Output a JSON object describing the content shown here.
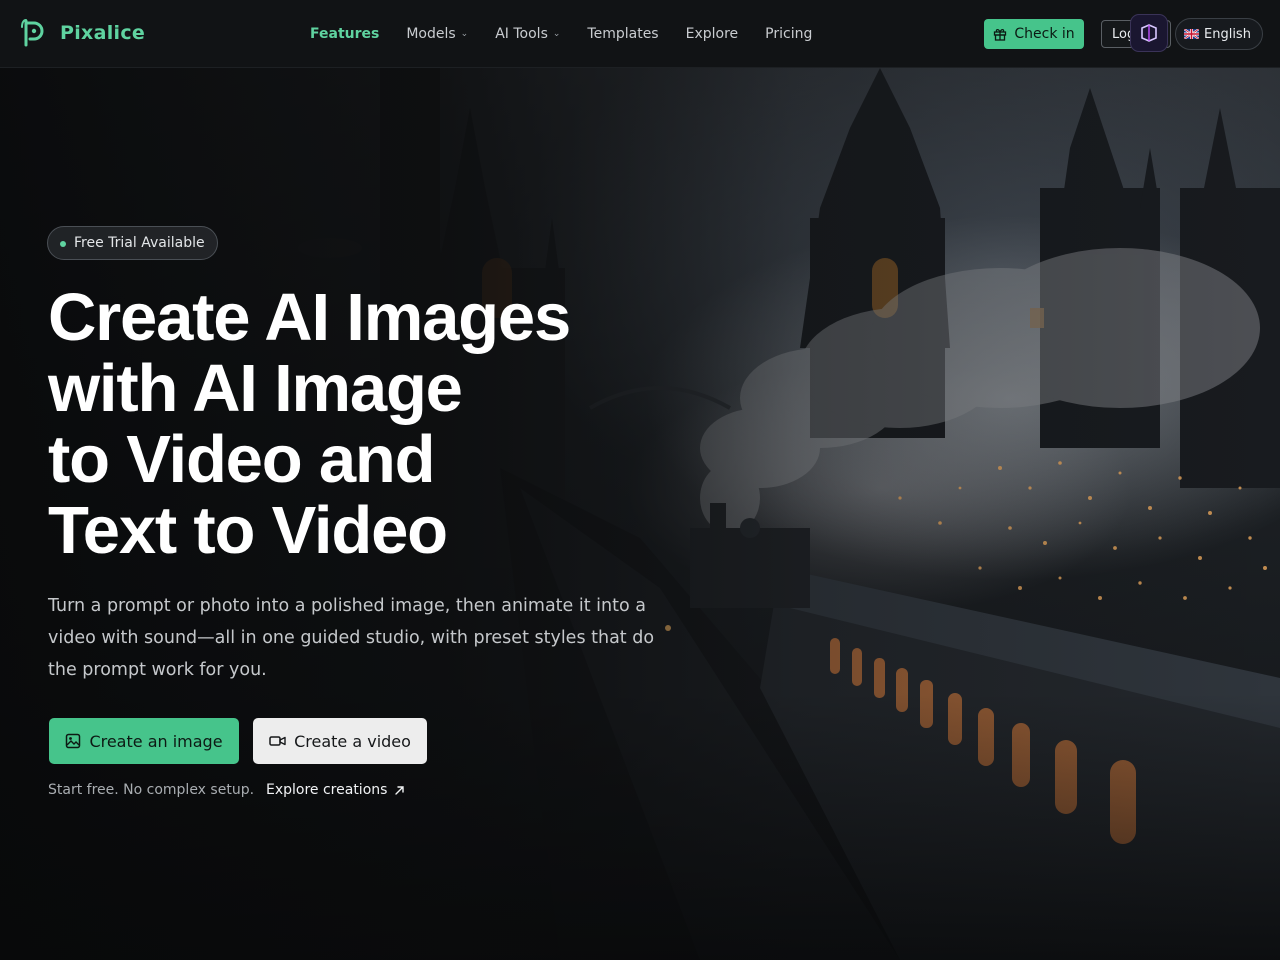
{
  "brand": {
    "name": "Pixalice",
    "accent": "#46c48b",
    "logo_icon": "pixalice-logo-icon"
  },
  "nav": {
    "items": [
      {
        "label": "Features",
        "active": true,
        "has_dropdown": false
      },
      {
        "label": "Models",
        "active": false,
        "has_dropdown": true
      },
      {
        "label": "AI Tools",
        "active": false,
        "has_dropdown": true
      },
      {
        "label": "Templates",
        "active": false,
        "has_dropdown": false
      },
      {
        "label": "Explore",
        "active": false,
        "has_dropdown": false
      },
      {
        "label": "Pricing",
        "active": false,
        "has_dropdown": false
      }
    ],
    "checkin_label": "Check in",
    "checkin_icon": "gift-icon",
    "login_label": "Log in",
    "language_label": "English",
    "language_flag": "uk-flag-icon"
  },
  "hero": {
    "badge": "Free Trial Available",
    "headline_lines": [
      "Create AI Images",
      "with AI Image",
      "to Video and",
      "Text to Video"
    ],
    "subtext": "Turn a prompt or photo into a polished image, then animate it into a video with sound—all in one guided studio, with preset styles that do the prompt work for you.",
    "primary_button": {
      "label": "Create an image",
      "icon": "image-icon"
    },
    "secondary_button": {
      "label": "Create a video",
      "icon": "video-camera-icon"
    },
    "note": "Start free. No complex setup.",
    "explore_link": {
      "label": "Explore creations",
      "icon": "arrow-up-right-icon"
    }
  }
}
